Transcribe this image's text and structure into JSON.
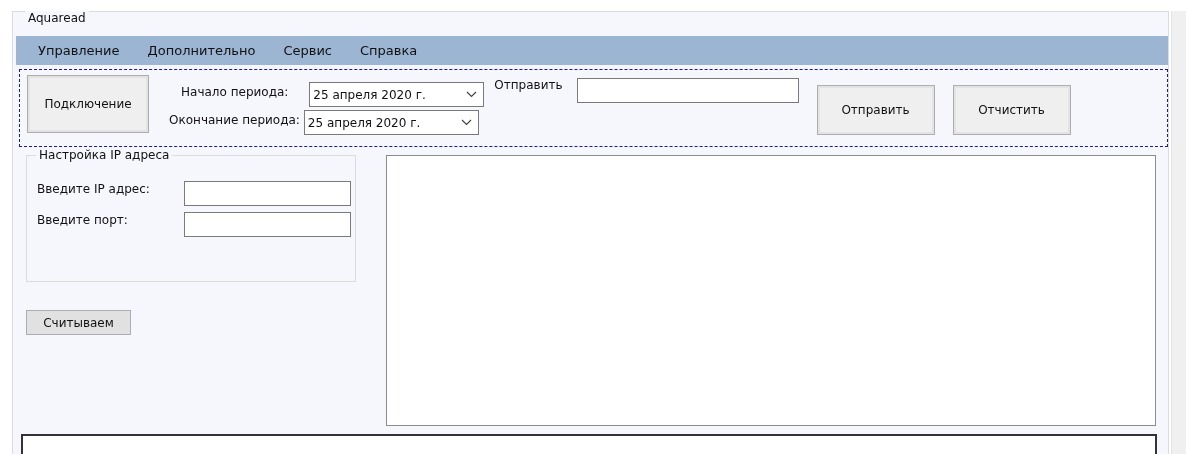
{
  "group_title": "Aquaread",
  "menu": [
    {
      "label": "Управление"
    },
    {
      "label": "Дополнительно"
    },
    {
      "label": "Сервис"
    },
    {
      "label": "Справка"
    }
  ],
  "toolbar": {
    "connect_button": "Подключение",
    "start": {
      "label": "Начало периода:",
      "value": "25  апреля  2020 г."
    },
    "end": {
      "label": "Окончание периода:",
      "value": "25  апреля  2020 г."
    },
    "send_label": "Отправить",
    "send_button": "Отправить",
    "clear_button": "Отчистить"
  },
  "ip_settings": {
    "title": "Настройка IP адреса",
    "fields": [
      {
        "label": "Введите IP адрес:"
      },
      {
        "label": "Введите порт:"
      }
    ]
  },
  "read_button": "Считываем"
}
